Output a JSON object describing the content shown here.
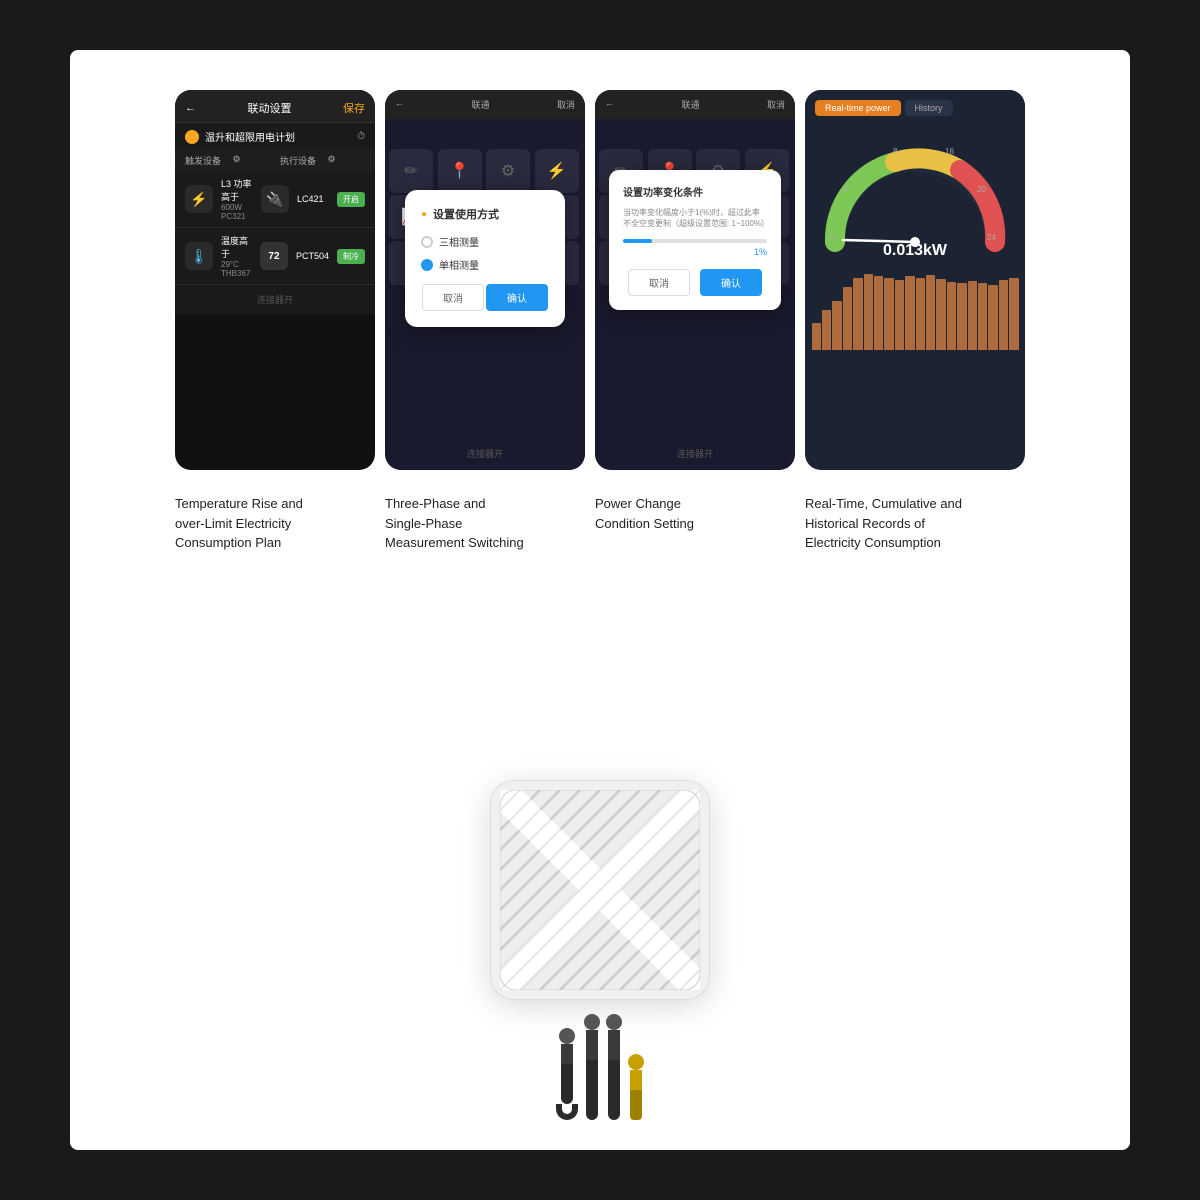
{
  "page": {
    "bg": "#1a1a1a",
    "card_bg": "#ffffff"
  },
  "screens": [
    {
      "id": "screen1",
      "type": "dark_linkage",
      "header_title": "联动设置",
      "save_btn": "保存",
      "plan_title": "温升和超限用电计划",
      "trigger_label": "触发设备",
      "exec_label": "执行设备",
      "devices": [
        {
          "icon": "⚡",
          "name": "L3 功率高于",
          "value": "600W",
          "id": "PC321",
          "exec_id": "LC421",
          "exec_icon": "🔌",
          "toggle": "开启"
        },
        {
          "icon": "🌡",
          "name": "温度高于",
          "value": "29°C",
          "id": "THB367",
          "exec_id": "PCT504",
          "exec_val": "72",
          "exec_icon": "📊",
          "toggle": "制冷"
        }
      ]
    },
    {
      "id": "screen2",
      "type": "dialog_phase",
      "dialog_title": "设置使用方式",
      "options": [
        {
          "label": "三相测量",
          "selected": false
        },
        {
          "label": "单相测量",
          "selected": true
        }
      ],
      "cancel": "取消",
      "confirm": "确认"
    },
    {
      "id": "screen3",
      "type": "dialog_power",
      "dialog_title": "设置功率变化条件",
      "desc": "当功率变化幅度小于1(%)时，超过此率不全空变更制（超级设置范围: 1~100%）",
      "slider_value": "1%",
      "cancel": "取消",
      "confirm": "确认"
    },
    {
      "id": "screen4",
      "type": "gauge",
      "tab_realtime": "Real-time power",
      "tab_history": "History",
      "value": "0.013kW",
      "gauge_labels": [
        "0",
        "4",
        "8",
        "16",
        "20",
        "24"
      ]
    }
  ],
  "captions": [
    {
      "id": "cap1",
      "lines": [
        "Temperature Rise and",
        "over-Limit Electricity",
        "Consumption Plan"
      ]
    },
    {
      "id": "cap2",
      "lines": [
        "Three-Phase and",
        "Single-Phase",
        "Measurement Switching"
      ]
    },
    {
      "id": "cap3",
      "lines": [
        "Power Change",
        "Condition Setting"
      ]
    },
    {
      "id": "cap4",
      "lines": [
        "Real-Time, Cumulative and",
        "Historical Records of",
        "Electricity Consumption"
      ]
    }
  ],
  "device": {
    "alt": "Smart Energy Monitor Device",
    "connectors": [
      {
        "type": "regular"
      },
      {
        "type": "regular"
      },
      {
        "type": "regular"
      },
      {
        "type": "gold"
      }
    ]
  }
}
